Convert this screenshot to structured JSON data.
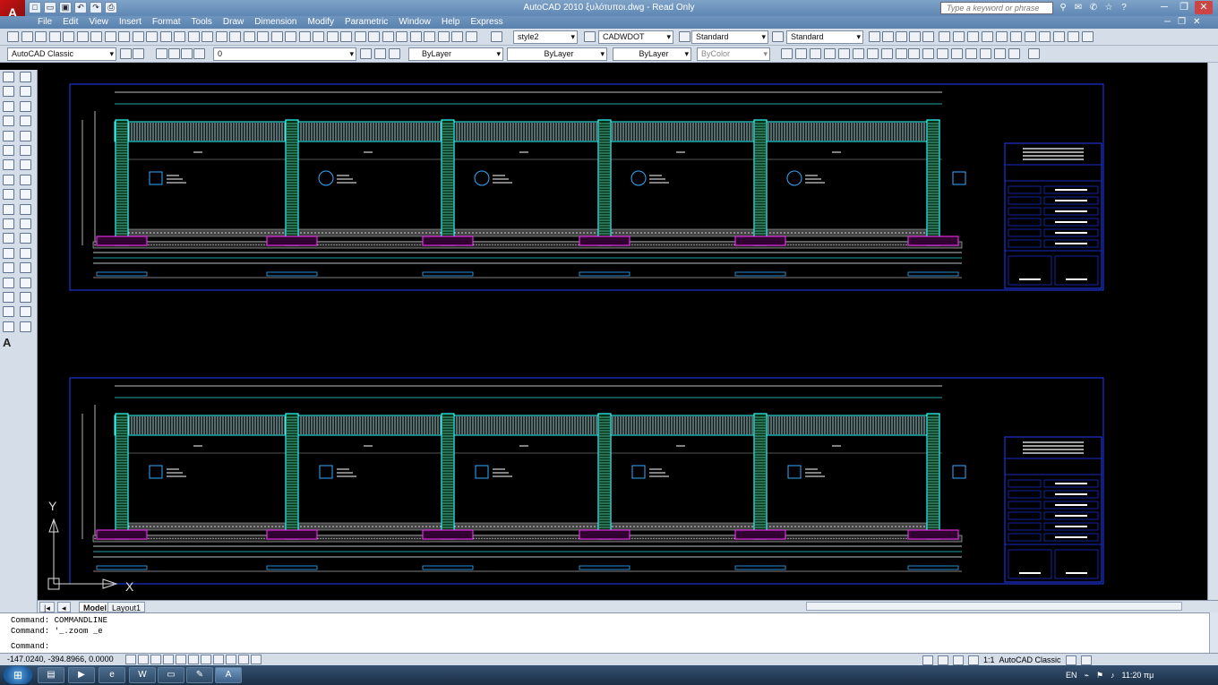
{
  "window": {
    "title": "AutoCAD 2010        ξυλότυποι.dwg - Read Only",
    "app_icon": "autocad-logo-icon",
    "search_placeholder": "Type a keyword or phrase",
    "min_label": "─",
    "restore_label": "❐",
    "close_label": "✕"
  },
  "menu": {
    "items": [
      "File",
      "Edit",
      "View",
      "Insert",
      "Format",
      "Tools",
      "Draw",
      "Dimension",
      "Modify",
      "Parametric",
      "Window",
      "Help",
      "Express"
    ],
    "right_min": "─",
    "right_restore": "❐",
    "right_close": "✕"
  },
  "toolbar_styles": {
    "text_style": "style2",
    "dim_style": "CADWDOT",
    "table_style": "Standard",
    "mleader_style": "Standard"
  },
  "toolbar_layers": {
    "workspace": "AutoCAD Classic",
    "layer": "0",
    "color": "ByLayer",
    "linetype": "ByLayer",
    "lineweight": "ByLayer",
    "plotstyle": "ByColor"
  },
  "ucs": {
    "y_label": "Y",
    "x_label": "X"
  },
  "titleblock": {
    "header_lines": [
      "ΕΛΛΗΝΙΚΗ ΔΗΜΟΚΡΑΤΙΑ",
      "ΠΕΡΙΦΕΡΕΙΑ ΚΕΝΤΡΙΚΗΣ ΜΑΚΕΔΟΝΙΑΣ",
      "ΤΜΗΜΑ ΤΟΠ. ΑΥΤ. & ΔΙΕΥΘ. ΠΕΙΡΑΙΑ",
      "ΤΜΗΜΑ Τ.Υ. Δ.Ε."
    ],
    "project_label": "ΕΡΓΟ:",
    "project_text": "Κατασκευή ξυλ. μονάδας ...",
    "field_labels": [
      "ΘΕΣΗ:",
      "ΜΕΛΕΤΗΤΗΣ:"
    ],
    "footer": "ΣΧΕΔΙΑΣΗ – ΥΠΟΓΡΑΦΕΣ"
  },
  "tabs": {
    "model": "Model",
    "layout1": "Layout1"
  },
  "command": {
    "line1": "Command: COMMANDLINE",
    "line2": "Command: '_.zoom _e",
    "prompt": "Command:"
  },
  "status": {
    "coords": "-147.0240, -394.8966, 0.0000",
    "annotation_scale": "1:1",
    "workspace": "AutoCAD Classic"
  },
  "taskbar": {
    "start_icon": "windows-start-icon",
    "language": "EN",
    "time": "11:20 πμ"
  }
}
